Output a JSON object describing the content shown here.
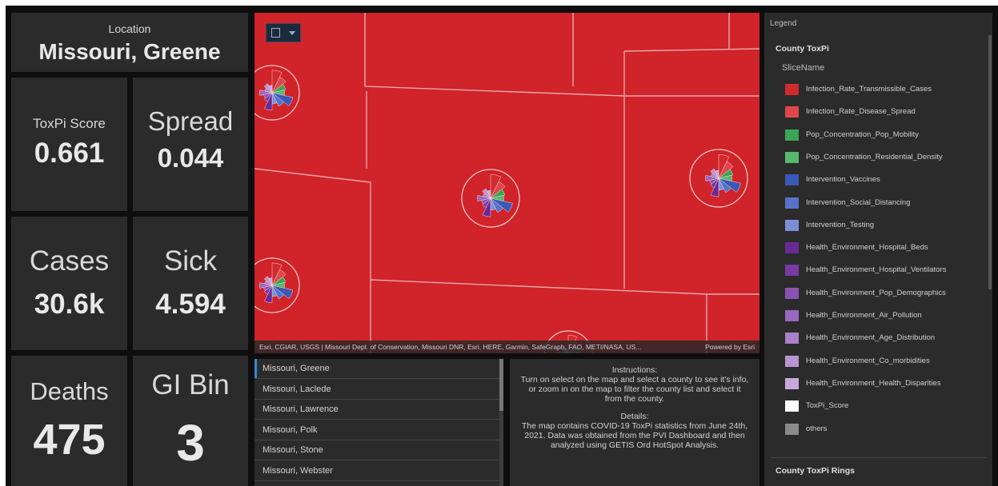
{
  "location": {
    "caption": "Location",
    "value": "Missouri, Greene"
  },
  "tiles": {
    "toxpi": {
      "label": "ToxPi Score",
      "value": "0.661"
    },
    "spread": {
      "label": "Spread",
      "value": "0.044"
    },
    "cases": {
      "label": "Cases",
      "value": "30.6k"
    },
    "sick": {
      "label": "Sick",
      "value": "4.594"
    },
    "deaths": {
      "label": "Deaths",
      "value": "475"
    },
    "gibin": {
      "label": "GI Bin",
      "value": "3"
    }
  },
  "map": {
    "attribution": "Esri, CGIAR, USGS | Missouri Dept. of Conservation, Missouri DNR, Esri, HERE, Garmin, SafeGraph, FAO, METI/NASA, US...",
    "powered_by": "Powered by Esri",
    "fill_color": "#d0232a"
  },
  "county_list": [
    "Missouri, Greene",
    "Missouri, Laclede",
    "Missouri, Lawrence",
    "Missouri, Polk",
    "Missouri, Stone",
    "Missouri, Webster"
  ],
  "info": {
    "instructions_title": "Instructions:",
    "instructions_text": "Turn on select on the map and select a county to see it's info, or zoom in on the map to filter the county list and select it from the county.",
    "details_title": "Details:",
    "details_text": "The map contains COVID-19 ToxPi statistics from June 24th, 2021. Data was obtained from the PVI Dashboard and then analyzed using GETIS Ord HotSpot Analysis."
  },
  "legend": {
    "title": "Legend",
    "layer1": "County ToxPi",
    "field": "SliceName",
    "items": [
      {
        "label": "Infection_Rate_Transmissible_Cases",
        "color": "#d12a2f"
      },
      {
        "label": "Infection_Rate_Disease_Spread",
        "color": "#e0474c"
      },
      {
        "label": "Pop_Concentration_Pop_Mobility",
        "color": "#3aa655"
      },
      {
        "label": "Pop_Concentration_Residential_Density",
        "color": "#56b86c"
      },
      {
        "label": "Intervention_Vaccines",
        "color": "#3a58b8"
      },
      {
        "label": "Intervention_Social_Distancing",
        "color": "#5671c8"
      },
      {
        "label": "Intervention_Testing",
        "color": "#7b8fd6"
      },
      {
        "label": "Health_Environment_Hospital_Beds",
        "color": "#6a2a96"
      },
      {
        "label": "Health_Environment_Hospital_Ventilators",
        "color": "#7a3aa6"
      },
      {
        "label": "Health_Environment_Pop_Demographics",
        "color": "#8b52b4"
      },
      {
        "label": "Health_Environment_Air_Pollution",
        "color": "#9a68bf"
      },
      {
        "label": "Health_Environment_Age_Distribution",
        "color": "#aa80c8"
      },
      {
        "label": "Health_Environment_Co_morbidities",
        "color": "#b894d2"
      },
      {
        "label": "Health_Environment_Health_Disparities",
        "color": "#c6a8dc"
      },
      {
        "label": "ToxPi_Score",
        "color": "#ffffff"
      },
      {
        "label": "others",
        "color": "#8a8a8a"
      }
    ],
    "layer2": "County ToxPi Rings"
  }
}
